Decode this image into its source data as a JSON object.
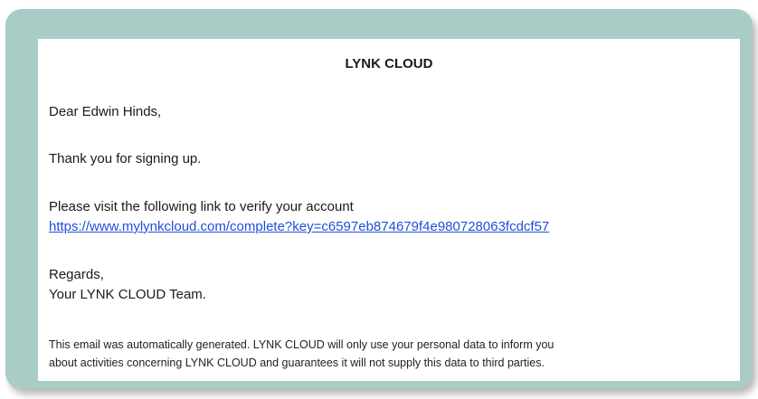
{
  "email": {
    "title": "LYNK CLOUD",
    "greeting": "Dear Edwin Hinds,",
    "thanks": "Thank you for signing up.",
    "visit_text": "Please visit the following link to verify your account",
    "link_text": "https://www.mylynkcloud.com/complete?key=c6597eb874679f4e980728063fcdcf57",
    "regards": "Regards,",
    "signature": "Your LYNK CLOUD Team.",
    "footer_line1": "This email was automatically generated. LYNK CLOUD will only use your personal data to inform you",
    "footer_line2": "about activities concerning LYNK CLOUD and guarantees it will not supply this data to third parties."
  },
  "colors": {
    "frame_bg": "#a9ccc7",
    "link": "#1f4ed8"
  }
}
